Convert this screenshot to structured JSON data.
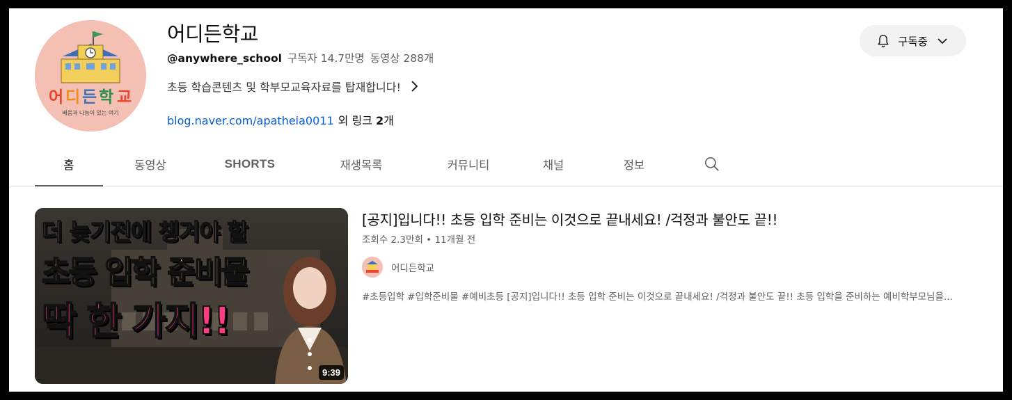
{
  "channel": {
    "name": "어디든학교",
    "handle": "@anywhere_school",
    "subscribers": "구독자 14.7만명",
    "video_count": "동영상 288개",
    "description": "초등 학습콘텐츠 및 학부모교육자료를 탑재합니다!",
    "link_text": "blog.naver.com/apatheia0011",
    "more_links_prefix": "외 링크 ",
    "more_links_count": "2",
    "more_links_suffix": "개",
    "avatar_title": "어디든학교",
    "avatar_subtitle": "배움과 나눔이 있는 여기"
  },
  "subscribe_button": {
    "label": "구독중",
    "icon": "bell-icon",
    "chevron": "chevron-down-icon"
  },
  "tabs": [
    {
      "label": "홈",
      "active": true
    },
    {
      "label": "동영상"
    },
    {
      "label": "SHORTS"
    },
    {
      "label": "재생목록"
    },
    {
      "label": "커뮤니티"
    },
    {
      "label": "채널"
    },
    {
      "label": "정보"
    }
  ],
  "featured_video": {
    "title": "[공지]입니다!! 초등 입학 준비는 이것으로 끝내세요! /걱정과 불안도 끝!!",
    "views": "조회수 2.3만회",
    "dot": "•",
    "age": "11개월 전",
    "channel": "어디든학교",
    "description": "#초등입학 #입학준비물 #예비초등 [공지]입니다!! 초등 입학 준비는 이것으로 끝내세요! /걱정과 불안도 끝!! 초등 입학을 준비하는 예비학부모님을...",
    "duration": "9:39",
    "thumb_line1": "더 늦기전에 챙겨야 할",
    "thumb_line2": "초등 입학 준비물",
    "thumb_line3": "딱 한 가지!!"
  },
  "colors": {
    "link": "#065fd4",
    "avatar_bg": "#f5c0b4",
    "thumb_yellow": "#f7e85a",
    "thumb_pink": "#ff3d7f"
  }
}
